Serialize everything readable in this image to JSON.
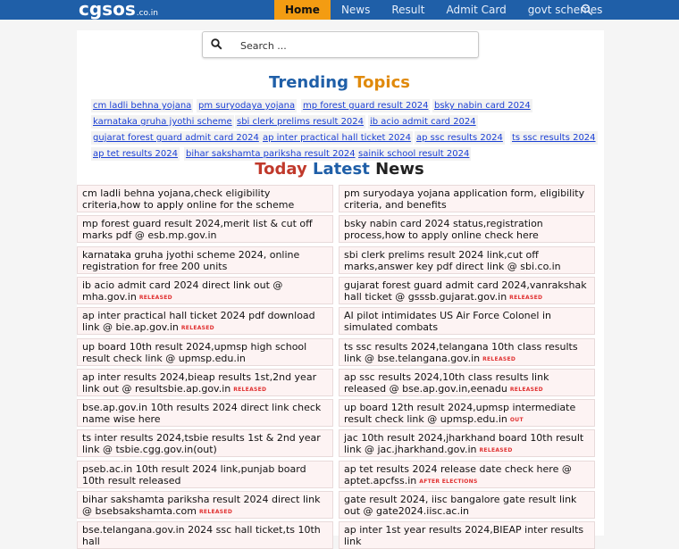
{
  "header": {
    "logo_main": "cgsos",
    "logo_suffix": ".co.in",
    "nav": [
      "Home",
      "News",
      "Result",
      "Admit Card",
      "govt schemes"
    ],
    "active_nav": "Home",
    "accent_color": "#f39c12",
    "bar_color": "#1f5fa8"
  },
  "search": {
    "placeholder": "Search ...",
    "icon": "search-icon"
  },
  "trending": {
    "title_part1": "Trending",
    "title_part2": "Topics",
    "tags": [
      "cm ladli behna yojana",
      "pm suryodaya yojana",
      "mp forest guard result 2024",
      "bsky nabin card 2024",
      "karnataka gruha jyothi scheme",
      "sbi clerk prelims result 2024",
      "ib acio admit card 2024",
      "gujarat forest guard admit card 2024",
      "ap inter practical hall ticket 2024",
      "ap ssc results 2024",
      "ts ssc results 2024",
      "ap tet results 2024",
      "bihar sakshamta pariksha result 2024",
      "sainik school result 2024"
    ]
  },
  "news": {
    "title_part1": "Today",
    "title_part2": "Latest",
    "title_part3": "News",
    "items": [
      {
        "text": "cm ladli behna yojana,check eligibility criteria,how to apply online for the scheme",
        "badge": ""
      },
      {
        "text": "pm suryodaya yojana application form, eligibility criteria, and benefits",
        "badge": ""
      },
      {
        "text": "mp forest guard result 2024,merit list & cut off marks pdf @ esb.mp.gov.in",
        "badge": ""
      },
      {
        "text": "bsky nabin card 2024 status,registration process,how to apply online check here",
        "badge": ""
      },
      {
        "text": "karnataka gruha jyothi scheme 2024, online registration for free 200 units",
        "badge": ""
      },
      {
        "text": "sbi clerk prelims result 2024 link,cut off marks,answer key pdf direct link @ sbi.co.in",
        "badge": ""
      },
      {
        "text": "ib acio admit card 2024 direct link out @ mha.gov.in",
        "badge": "RELEASED"
      },
      {
        "text": "gujarat forest guard admit card 2024,vanrakshak hall ticket @ gsssb.gujarat.gov.in",
        "badge": "RELEASED"
      },
      {
        "text": "ap inter practical hall ticket 2024 pdf download link @ bie.ap.gov.in",
        "badge": "RELEASED"
      },
      {
        "text": "AI pilot intimidates US Air Force Colonel in simulated combats",
        "badge": ""
      },
      {
        "text": "up board 10th result 2024,upmsp high school result check link @ upmsp.edu.in",
        "badge": ""
      },
      {
        "text": "ts ssc results 2024,telangana 10th class results link @ bse.telangana.gov.in",
        "badge": "RELEASED"
      },
      {
        "text": "ap inter results 2024,bieap results 1st,2nd year link out @ resultsbie.ap.gov.in",
        "badge": "RELEASED"
      },
      {
        "text": "ap ssc results 2024,10th class results link released @ bse.ap.gov.in,eenadu",
        "badge": "RELEASED"
      },
      {
        "text": "bse.ap.gov.in 10th results 2024 direct link check name wise here",
        "badge": ""
      },
      {
        "text": "up board 12th result 2024,upmsp intermediate result check link @ upmsp.edu.in",
        "badge": "OUT"
      },
      {
        "text": "ts inter results 2024,tsbie results 1st & 2nd year link @ tsbie.cgg.gov.in(out)",
        "badge": ""
      },
      {
        "text": "jac 10th result 2024,jharkhand board 10th result link @ jac.jharkhand.gov.in",
        "badge": "RELEASED"
      },
      {
        "text": "pseb.ac.in 10th result 2024 link,punjab board 10th result released",
        "badge": ""
      },
      {
        "text": "ap tet results 2024 release date check here @ aptet.apcfss.in",
        "badge": "AFTER ELECTIONS"
      },
      {
        "text": "bihar sakshamta pariksha result 2024 direct link @ bsebsakshamta.com",
        "badge": "RELEASED"
      },
      {
        "text": "gate result 2024, iisc bangalore gate result link out @ gate2024.iisc.ac.in",
        "badge": ""
      },
      {
        "text": "bse.telangana.gov.in 2024 ssc hall ticket,ts 10th hall",
        "badge": ""
      },
      {
        "text": "ap inter 1st year results 2024,BIEAP inter results link",
        "badge": ""
      }
    ]
  }
}
